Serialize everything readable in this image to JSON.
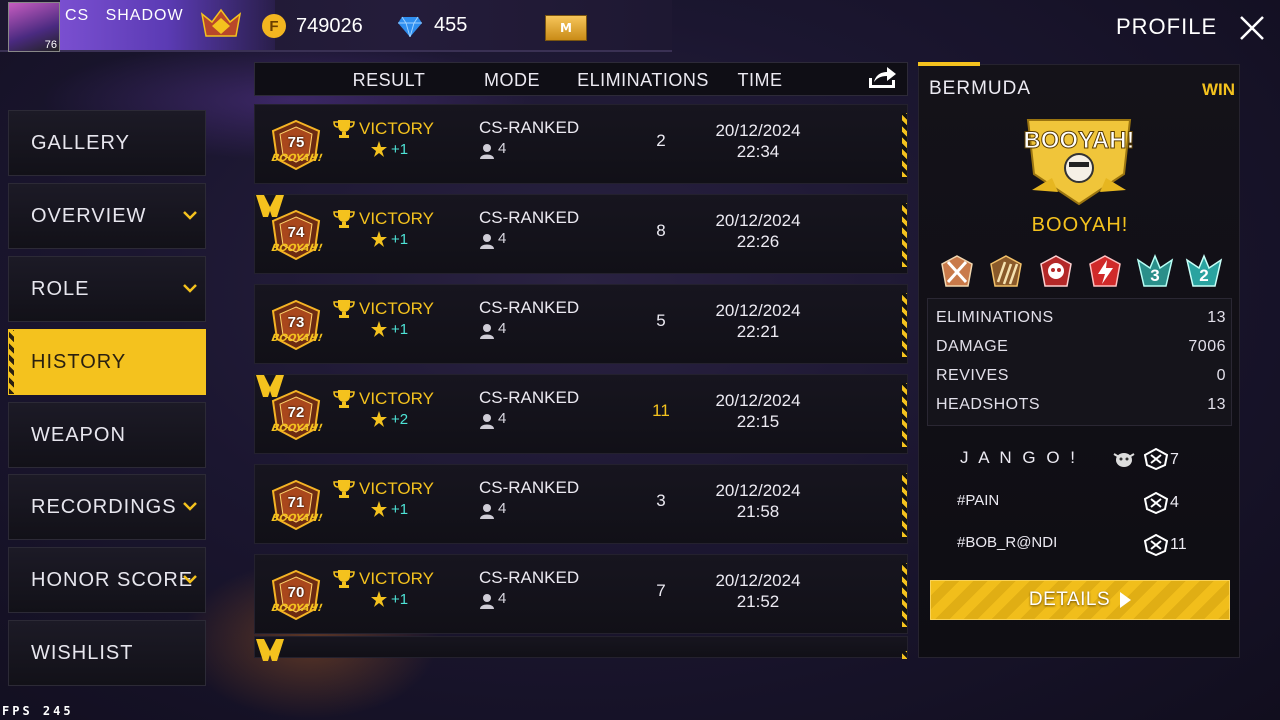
{
  "player": {
    "clan": "CS",
    "name": "SHADOW",
    "level": "76"
  },
  "currency": {
    "gold": "749026",
    "diamonds": "455",
    "card": "M"
  },
  "header": {
    "title": "PROFILE"
  },
  "sidebar": {
    "items": [
      {
        "label": "GALLERY",
        "expandable": false,
        "active": false
      },
      {
        "label": "OVERVIEW",
        "expandable": true,
        "active": false
      },
      {
        "label": "ROLE",
        "expandable": true,
        "active": false
      },
      {
        "label": "HISTORY",
        "expandable": false,
        "active": true
      },
      {
        "label": "WEAPON",
        "expandable": false,
        "active": false
      },
      {
        "label": "RECORDINGS",
        "expandable": true,
        "active": false
      },
      {
        "label": "HONOR SCORE",
        "expandable": true,
        "active": false
      },
      {
        "label": "WISHLIST",
        "expandable": false,
        "active": false
      }
    ]
  },
  "table": {
    "columns": {
      "result": "RESULT",
      "mode": "MODE",
      "eliminations": "ELIMINATIONS",
      "time": "TIME"
    },
    "rows": [
      {
        "rank": "75",
        "booyah": "BOOYAH!",
        "mvp": false,
        "result": "VICTORY",
        "points": "+1",
        "mode": "CS-RANKED",
        "squad": "4",
        "eliminations": "2",
        "date": "20/12/2024",
        "time": "22:34"
      },
      {
        "rank": "74",
        "booyah": "BOOYAH!",
        "mvp": true,
        "result": "VICTORY",
        "points": "+1",
        "mode": "CS-RANKED",
        "squad": "4",
        "eliminations": "8",
        "date": "20/12/2024",
        "time": "22:26"
      },
      {
        "rank": "73",
        "booyah": "BOOYAH!",
        "mvp": false,
        "result": "VICTORY",
        "points": "+1",
        "mode": "CS-RANKED",
        "squad": "4",
        "eliminations": "5",
        "date": "20/12/2024",
        "time": "22:21"
      },
      {
        "rank": "72",
        "booyah": "BOOYAH!",
        "mvp": true,
        "result": "VICTORY",
        "points": "+2",
        "mode": "CS-RANKED",
        "squad": "4",
        "eliminations": "11",
        "date": "20/12/2024",
        "time": "22:15"
      },
      {
        "rank": "71",
        "booyah": "BOOYAH!",
        "mvp": false,
        "result": "VICTORY",
        "points": "+1",
        "mode": "CS-RANKED",
        "squad": "4",
        "eliminations": "3",
        "date": "20/12/2024",
        "time": "21:58"
      },
      {
        "rank": "70",
        "booyah": "BOOYAH!",
        "mvp": false,
        "result": "VICTORY",
        "points": "+1",
        "mode": "CS-RANKED",
        "squad": "4",
        "eliminations": "7",
        "date": "20/12/2024",
        "time": "21:52"
      }
    ]
  },
  "detail": {
    "map": "BERMUDA",
    "result": "WIN",
    "logo_text": "BOOYAH!",
    "title": "BOOYAH!",
    "medal_numbers": [
      "3",
      "2"
    ],
    "stats": [
      {
        "label": "ELIMINATIONS",
        "value": "13"
      },
      {
        "label": "DAMAGE",
        "value": "7006"
      },
      {
        "label": "REVIVES",
        "value": "0"
      },
      {
        "label": "HEADSHOTS",
        "value": "13"
      }
    ],
    "teammates": [
      {
        "name": "J A N G O   !",
        "kills": "7"
      },
      {
        "name": "#PAIN",
        "kills": "4"
      },
      {
        "name": "#BOB_R@NDI",
        "kills": "11"
      }
    ],
    "details_label": "DETAILS"
  },
  "fps": "FPS 245",
  "colors": {
    "accent": "#f4c21e",
    "teal": "#4ee3d6",
    "background": "#1b1630"
  }
}
